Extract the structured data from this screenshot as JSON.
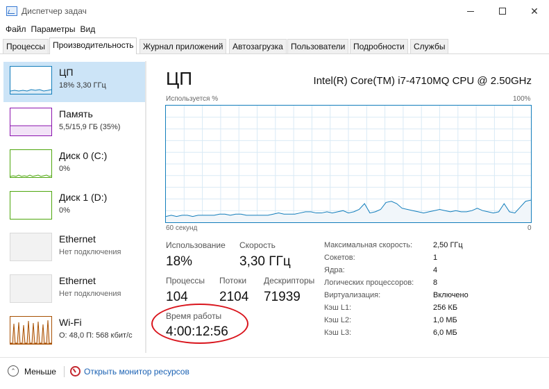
{
  "window": {
    "title": "Диспетчер задач",
    "controls": {
      "minimize": "minimize-icon",
      "maximize": "maximize-icon",
      "close": "✕"
    }
  },
  "menu": [
    "Файл",
    "Параметры",
    "Вид"
  ],
  "tabs": [
    {
      "label": "Процессы",
      "active": false
    },
    {
      "label": "Производительность",
      "active": true
    },
    {
      "label": "Журнал приложений",
      "active": false
    },
    {
      "label": "Автозагрузка",
      "active": false
    },
    {
      "label": "Пользователи",
      "active": false
    },
    {
      "label": "Подробности",
      "active": false
    },
    {
      "label": "Службы",
      "active": false
    }
  ],
  "sidebar": {
    "items": [
      {
        "title": "ЦП",
        "subtitle": "18% 3,30 ГГц",
        "color": "#117dbb",
        "selected": true
      },
      {
        "title": "Память",
        "subtitle": "5,5/15,9 ГБ (35%)",
        "color": "#8b12ae",
        "selected": false
      },
      {
        "title": "Диск 0 (C:)",
        "subtitle": "0%",
        "color": "#4da60c",
        "selected": false
      },
      {
        "title": "Диск 1 (D:)",
        "subtitle": "0%",
        "color": "#4da60c",
        "selected": false
      },
      {
        "title": "Ethernet",
        "subtitle": "Нет подключения",
        "color": "#d9d9d9",
        "selected": false
      },
      {
        "title": "Ethernet",
        "subtitle": "Нет подключения",
        "color": "#d9d9d9",
        "selected": false
      },
      {
        "title": "Wi-Fi",
        "subtitle": "О: 48,0  П: 568 кбит/с",
        "color": "#a74f01",
        "selected": false
      }
    ]
  },
  "main": {
    "title": "ЦП",
    "cpu_model": "Intel(R) Core(TM) i7-4710MQ CPU @ 2.50GHz",
    "graph": {
      "top_left_label": "Используется %",
      "top_right_label": "100%",
      "bottom_left_label": "60 секунд",
      "bottom_right_label": "0",
      "color": "#117dbb",
      "usage_percent": [
        5,
        6,
        5,
        6,
        6,
        5,
        6,
        6,
        6,
        6,
        7,
        7,
        6,
        7,
        7,
        6,
        6,
        6,
        6,
        6,
        7,
        8,
        7,
        7,
        7,
        8,
        9,
        9,
        8,
        8,
        9,
        8,
        9,
        10,
        8,
        9,
        11,
        16,
        8,
        9,
        11,
        17,
        18,
        16,
        12,
        11,
        10,
        9,
        8,
        9,
        10,
        11,
        10,
        9,
        10,
        9,
        9,
        10,
        12,
        10,
        9,
        8,
        9,
        16,
        9,
        8,
        13,
        18,
        19
      ]
    },
    "stats": {
      "usage_label": "Использование",
      "usage_value": "18%",
      "speed_label": "Скорость",
      "speed_value": "3,30 ГГц",
      "processes_label": "Процессы",
      "processes_value": "104",
      "threads_label": "Потоки",
      "threads_value": "2104",
      "handles_label": "Дескрипторы",
      "handles_value": "71939",
      "uptime_label": "Время работы",
      "uptime_value": "4:00:12:56"
    },
    "info": [
      {
        "label": "Максимальная скорость:",
        "value": "2,50 ГГц"
      },
      {
        "label": "Сокетов:",
        "value": "1"
      },
      {
        "label": "Ядра:",
        "value": "4"
      },
      {
        "label": "Логических процессоров:",
        "value": "8"
      },
      {
        "label": "Виртуализация:",
        "value": "Включено"
      },
      {
        "label": "Кэш L1:",
        "value": "256 КБ"
      },
      {
        "label": "Кэш L2:",
        "value": "1,0 МБ"
      },
      {
        "label": "Кэш L3:",
        "value": "6,0 МБ"
      }
    ],
    "highlight_color": "#d9141c"
  },
  "footer": {
    "less_label": "Меньше",
    "monitor_link": "Открыть монитор ресурсов"
  }
}
